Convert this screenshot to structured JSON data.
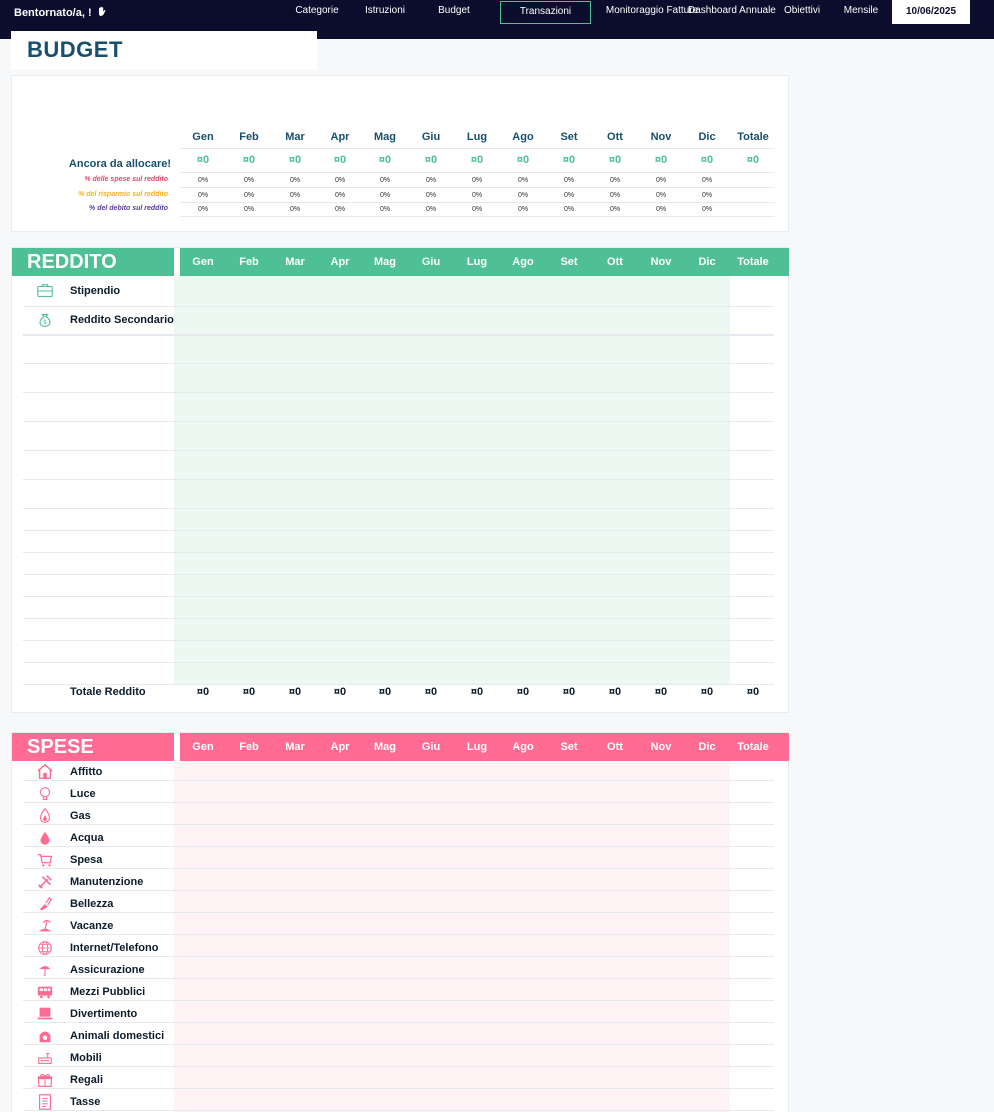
{
  "nav": {
    "welcome": "Bentornato/a, !",
    "items": [
      {
        "label": "Categorie",
        "active": false
      },
      {
        "label": "Istruzioni",
        "active": false
      },
      {
        "label": "Budget",
        "active": false
      },
      {
        "label": "Transazioni",
        "active": true
      },
      {
        "label": "Monitoraggio Fatture",
        "active": false
      },
      {
        "label": "Dashboard Annuale",
        "active": false
      },
      {
        "label": "Obiettivi",
        "active": false
      },
      {
        "label": "Mensile",
        "active": false
      }
    ],
    "date": "10/06/2025"
  },
  "page_title": "BUDGET",
  "months": [
    "Gen",
    "Feb",
    "Mar",
    "Apr",
    "Mag",
    "Giu",
    "Lug",
    "Ago",
    "Set",
    "Ott",
    "Nov",
    "Dic"
  ],
  "total_header": "Totale",
  "summary": {
    "to_allocate_label": "Ancora da allocare!",
    "to_allocate_value": "¤0",
    "rows": [
      {
        "label": "% delle spese sul reddito",
        "color": "#e8476f",
        "value": "0%"
      },
      {
        "label": "% del risparmio sul reddito",
        "color": "#f2b21b",
        "value": "0%"
      },
      {
        "label": "% del debito sul reddito",
        "color": "#5a3c9a",
        "value": "0%"
      }
    ]
  },
  "reddito": {
    "title": "REDDITO",
    "color": "#4fbf95",
    "rows": [
      {
        "label": "Stipendio",
        "icon": "briefcase-icon"
      },
      {
        "label": "Reddito Secondario",
        "icon": "money-bag-icon"
      }
    ],
    "total_label": "Totale Reddito",
    "total_value": "¤0"
  },
  "spese": {
    "title": "SPESE",
    "color": "#ff6b93",
    "rows": [
      {
        "label": "Affitto",
        "icon": "house-icon"
      },
      {
        "label": "Luce",
        "icon": "lightbulb-icon"
      },
      {
        "label": "Gas",
        "icon": "flame-icon"
      },
      {
        "label": "Acqua",
        "icon": "water-drop-icon"
      },
      {
        "label": "Spesa",
        "icon": "shopping-cart-icon"
      },
      {
        "label": "Manutenzione",
        "icon": "tools-icon"
      },
      {
        "label": "Bellezza",
        "icon": "beauty-icon"
      },
      {
        "label": "Vacanze",
        "icon": "vacation-icon"
      },
      {
        "label": "Internet/Telefono",
        "icon": "globe-icon"
      },
      {
        "label": "Assicurazione",
        "icon": "umbrella-icon"
      },
      {
        "label": "Mezzi Pubblici",
        "icon": "bus-icon"
      },
      {
        "label": "Divertimento",
        "icon": "laptop-icon"
      },
      {
        "label": "Animali domestici",
        "icon": "pet-icon"
      },
      {
        "label": "Mobili",
        "icon": "furniture-icon"
      },
      {
        "label": "Regali",
        "icon": "gift-icon"
      },
      {
        "label": "Tasse",
        "icon": "document-icon"
      }
    ]
  }
}
